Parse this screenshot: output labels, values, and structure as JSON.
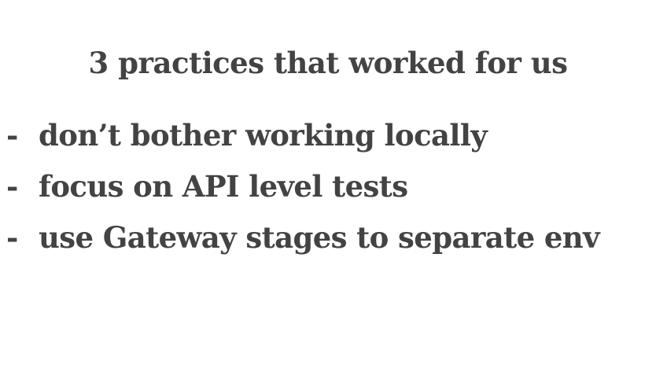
{
  "slide": {
    "title": "3 practices that worked for us",
    "bullets": [
      {
        "marker": "-",
        "text": "don’t bother working locally"
      },
      {
        "marker": "-",
        "text": "focus on API level tests"
      },
      {
        "marker": "-",
        "text": "use Gateway stages to separate env"
      }
    ]
  },
  "colors": {
    "background": "#ffffff",
    "text": "#434343"
  }
}
